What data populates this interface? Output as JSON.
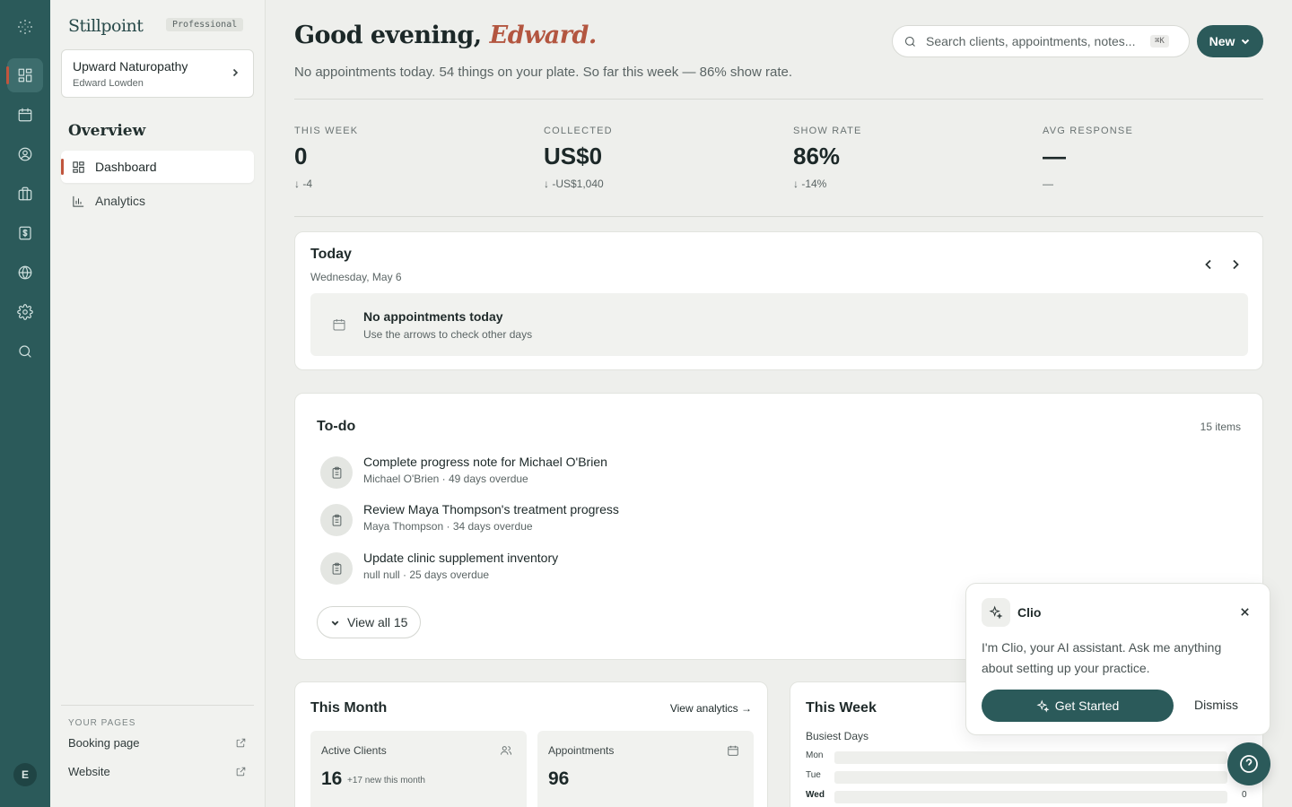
{
  "brand": {
    "name": "Stillpoint",
    "plan": "Professional"
  },
  "practice": {
    "name": "Upward Naturopathy",
    "owner": "Edward Lowden"
  },
  "sidebar": {
    "section_title": "Overview",
    "items": [
      {
        "label": "Dashboard",
        "icon": "dashboard-icon"
      },
      {
        "label": "Analytics",
        "icon": "bar-chart-icon"
      }
    ],
    "your_pages_label": "YOUR PAGES",
    "pages": [
      {
        "label": "Booking page",
        "icon": "external-link-icon"
      },
      {
        "label": "Website",
        "icon": "external-link-icon"
      }
    ]
  },
  "rail": {
    "items": [
      "dashboard-icon",
      "calendar-icon",
      "user-circle-icon",
      "briefcase-icon",
      "billing-icon",
      "globe-icon",
      "gear-icon",
      "search-icon"
    ],
    "avatar": "E"
  },
  "header": {
    "greeting": "Good evening, ",
    "name": "Edward.",
    "subline": "No appointments today. 54 things on your plate. So far this week — 86% show rate.",
    "search_placeholder": "Search clients, appointments, notes...",
    "search_shortcut": "⌘K",
    "new_label": "New"
  },
  "stats": [
    {
      "label": "THIS WEEK",
      "value": "0",
      "delta": "↓ -4"
    },
    {
      "label": "COLLECTED",
      "value": "US$0",
      "delta": "↓ -US$1,040"
    },
    {
      "label": "SHOW RATE",
      "value": "86%",
      "delta": "↓ -14%"
    },
    {
      "label": "AVG RESPONSE",
      "value": "—",
      "delta": "—"
    }
  ],
  "today": {
    "title": "Today",
    "date": "Wednesday, May 6",
    "empty_title": "No appointments today",
    "empty_sub": "Use the arrows to check other days"
  },
  "todo": {
    "title": "To-do",
    "count": "15 items",
    "items": [
      {
        "title": "Complete progress note for Michael O'Brien",
        "sub": "Michael O'Brien · 49 days overdue"
      },
      {
        "title": "Review Maya Thompson's treatment progress",
        "sub": "Maya Thompson · 34 days overdue"
      },
      {
        "title": "Update clinic supplement inventory",
        "sub": "null null · 25 days overdue"
      }
    ],
    "view_all": "View all 15"
  },
  "month": {
    "title": "This Month",
    "view_analytics": "View analytics →",
    "active_clients_label": "Active Clients",
    "active_clients_value": "16",
    "active_clients_note": "+17 new this month",
    "appointments_label": "Appointments",
    "appointments_value": "96"
  },
  "week": {
    "title": "This Week",
    "busiest_label": "Busiest Days",
    "days": [
      {
        "day": "Mon",
        "value": "",
        "fraction": 0
      },
      {
        "day": "Tue",
        "value": "",
        "fraction": 0
      },
      {
        "day": "Wed",
        "value": "0",
        "fraction": 0
      }
    ]
  },
  "clio": {
    "name": "Clio",
    "message": "I'm Clio, your AI assistant. Ask me anything about setting up your practice.",
    "cta": "Get Started",
    "dismiss": "Dismiss"
  },
  "colors": {
    "teal": "#2b5a5a",
    "accent": "#b35640"
  }
}
